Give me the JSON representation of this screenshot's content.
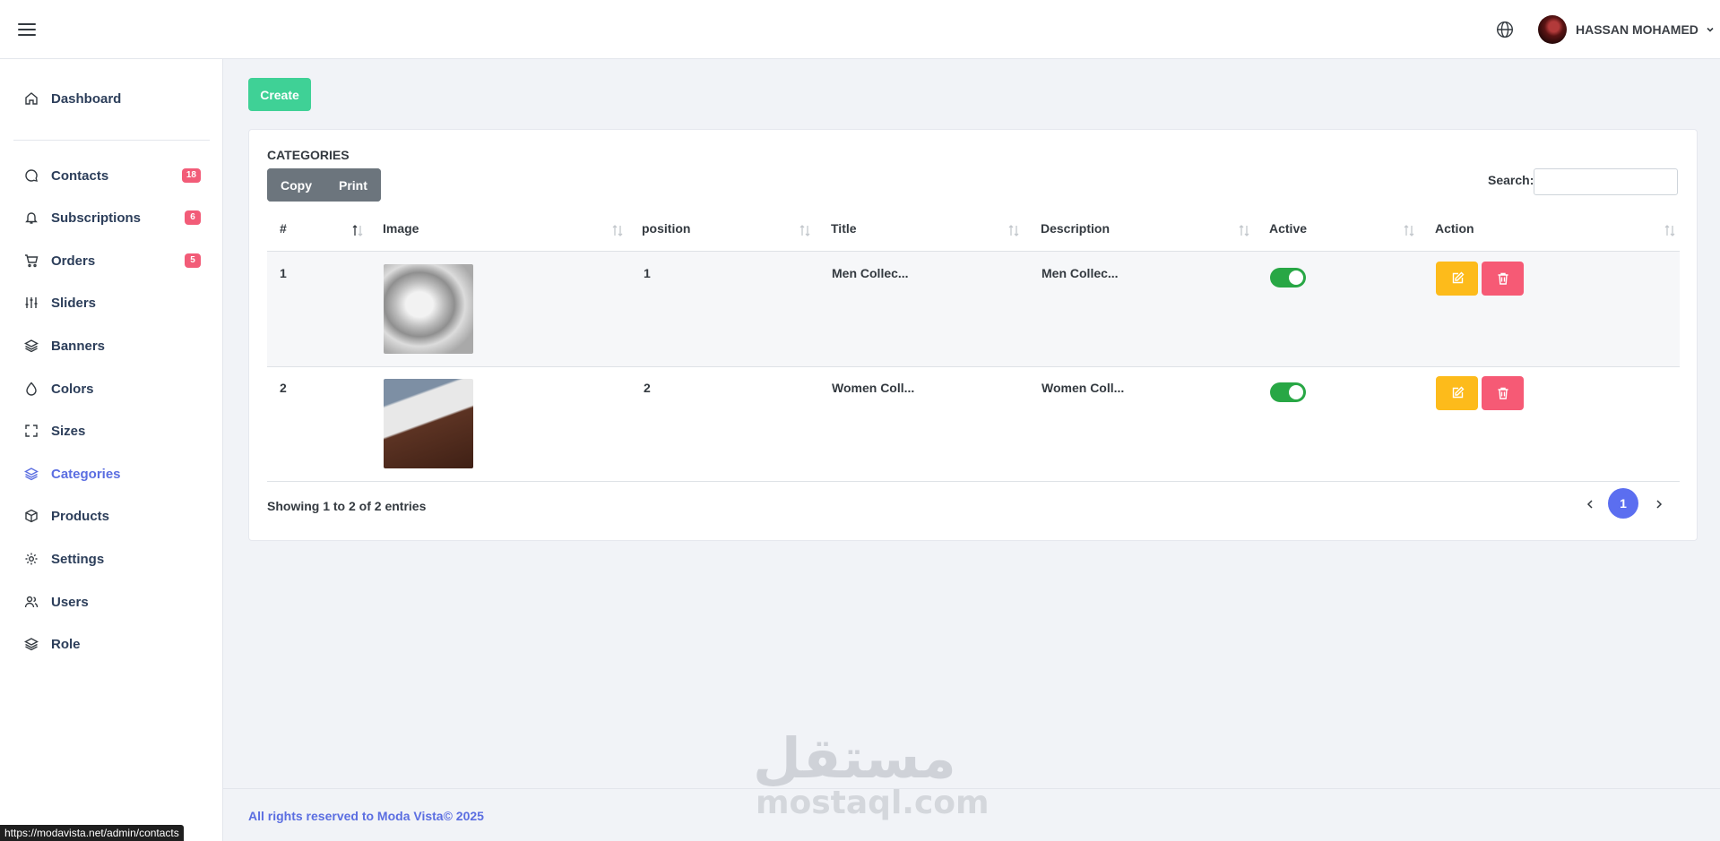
{
  "header": {
    "user_name": "HASSAN MOHAMED"
  },
  "sidebar": {
    "items": [
      {
        "label": "Dashboard",
        "icon": "home-icon"
      },
      {
        "label": "Contacts",
        "icon": "chat-icon",
        "badge": "18"
      },
      {
        "label": "Subscriptions",
        "icon": "bell-icon",
        "badge": "6"
      },
      {
        "label": "Orders",
        "icon": "cart-icon",
        "badge": "5"
      },
      {
        "label": "Sliders",
        "icon": "sliders-icon"
      },
      {
        "label": "Banners",
        "icon": "layers-icon"
      },
      {
        "label": "Colors",
        "icon": "droplet-icon"
      },
      {
        "label": "Sizes",
        "icon": "expand-icon"
      },
      {
        "label": "Categories",
        "icon": "layers-icon",
        "active": true
      },
      {
        "label": "Products",
        "icon": "box-icon"
      },
      {
        "label": "Settings",
        "icon": "gear-icon"
      },
      {
        "label": "Users",
        "icon": "users-icon"
      },
      {
        "label": "Role",
        "icon": "layers-icon"
      }
    ]
  },
  "main": {
    "create_label": "Create",
    "card_title": "CATEGORIES",
    "copy_label": "Copy",
    "print_label": "Print",
    "search_label": "Search:",
    "search_value": "",
    "columns": [
      "#",
      "Image",
      "position",
      "Title",
      "Description",
      "Active",
      "Action"
    ],
    "rows": [
      {
        "id": "1",
        "image": "sneakers-white-grey",
        "position": "1",
        "title": "Men Collec...",
        "description": "Men Collec...",
        "active": true
      },
      {
        "id": "2",
        "image": "sneakers-on-feet",
        "position": "2",
        "title": "Women Coll...",
        "description": "Women Coll...",
        "active": true
      }
    ],
    "info": "Showing 1 to 2 of 2 entries",
    "current_page": "1"
  },
  "watermark": {
    "arabic": "مستقل",
    "latin": "mostaql.com"
  },
  "footer": {
    "text": "All rights reserved to Moda Vista© 2025"
  },
  "status_bar": {
    "url": "https://modavista.net/admin/contacts"
  },
  "colors": {
    "accent": "#5b6ee1",
    "create": "#3fd196",
    "edit": "#fdbb1b",
    "delete": "#f65a75",
    "toggle_on": "#28a745",
    "badge": "#f25c78"
  }
}
